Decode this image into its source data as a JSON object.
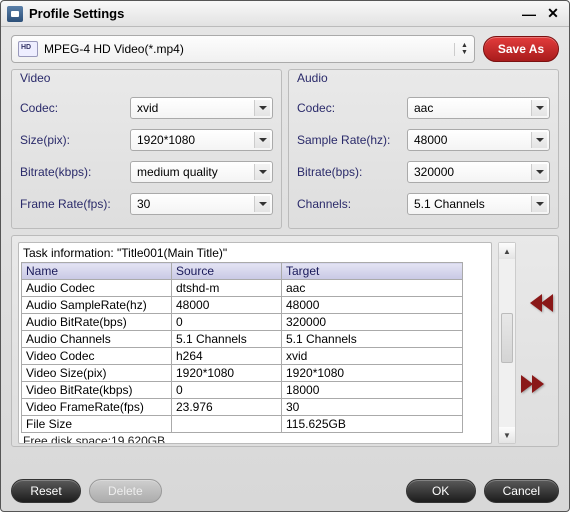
{
  "window_title": "Profile Settings",
  "profile": {
    "label": "MPEG-4 HD Video(*.mp4)"
  },
  "buttons": {
    "saveas": "Save As",
    "reset": "Reset",
    "delete": "Delete",
    "ok": "OK",
    "cancel": "Cancel"
  },
  "video": {
    "title": "Video",
    "fields": {
      "codec_label": "Codec:",
      "codec_value": "xvid",
      "size_label": "Size(pix):",
      "size_value": "1920*1080",
      "bitrate_label": "Bitrate(kbps):",
      "bitrate_value": "medium quality",
      "fps_label": "Frame Rate(fps):",
      "fps_value": "30"
    }
  },
  "audio": {
    "title": "Audio",
    "fields": {
      "codec_label": "Codec:",
      "codec_value": "aac",
      "sample_label": "Sample Rate(hz):",
      "sample_value": "48000",
      "bitrate_label": "Bitrate(bps):",
      "bitrate_value": "320000",
      "channels_label": "Channels:",
      "channels_value": "5.1 Channels"
    }
  },
  "task": {
    "caption": "Task information: \"Title001(Main Title)\"",
    "columns": {
      "name": "Name",
      "source": "Source",
      "target": "Target"
    },
    "rows": [
      {
        "name": "Audio Codec",
        "source": "dtshd-m",
        "target": "aac"
      },
      {
        "name": "Audio SampleRate(hz)",
        "source": "48000",
        "target": "48000"
      },
      {
        "name": "Audio BitRate(bps)",
        "source": "0",
        "target": "320000"
      },
      {
        "name": "Audio Channels",
        "source": "5.1 Channels",
        "target": "5.1 Channels"
      },
      {
        "name": "Video Codec",
        "source": "h264",
        "target": "xvid"
      },
      {
        "name": "Video Size(pix)",
        "source": "1920*1080",
        "target": "1920*1080"
      },
      {
        "name": "Video BitRate(kbps)",
        "source": "0",
        "target": "18000"
      },
      {
        "name": "Video FrameRate(fps)",
        "source": "23.976",
        "target": "30"
      },
      {
        "name": "File Size",
        "source": "",
        "target": "115.625GB"
      }
    ],
    "free_disk": "Free disk space:19.620GB"
  }
}
